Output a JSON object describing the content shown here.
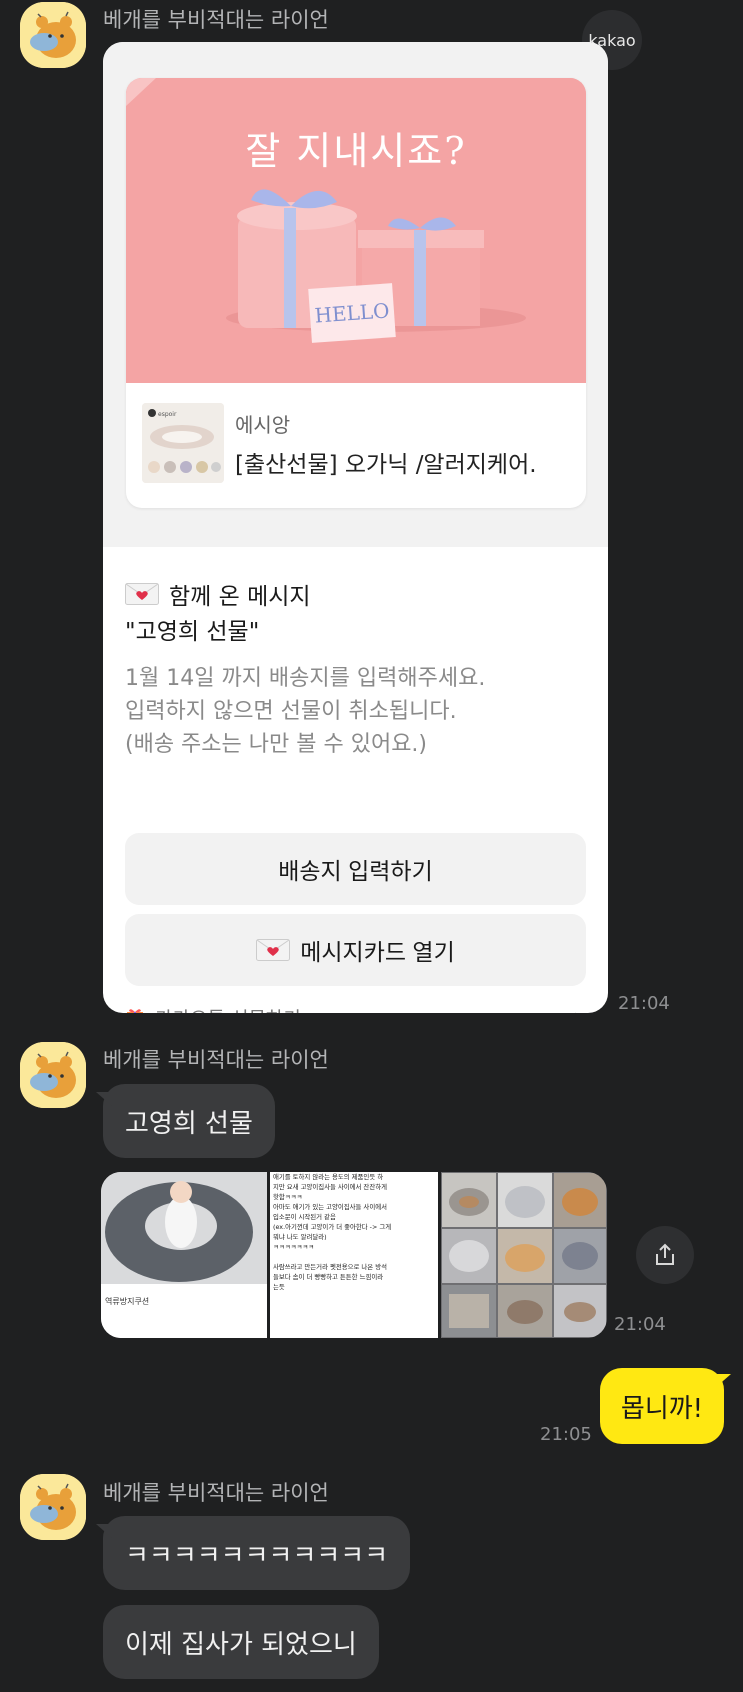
{
  "messages": {
    "sender_1": "베개를 부비적대는 라이언",
    "sender_2": "베개를 부비적대는 라이언",
    "sender_3": "베개를 부비적대는 라이언",
    "kakao_badge": "kakao",
    "time_1": "21:04",
    "time_2": "21:04",
    "time_3": "21:05",
    "bubble_gift_name": "고영희 선물",
    "my_reply": "몹니까!",
    "bubble_laugh": "ㅋㅋㅋㅋㅋㅋㅋㅋㅋㅋㅋ",
    "bubble_last": "이제 집사가 되었으니"
  },
  "gift": {
    "headline": "잘 지내시죠?",
    "card_text": "HELLO",
    "brand": "에시앙",
    "product_title": "[출산선물] 오가닉 /알러지케어.",
    "message_heading": "함께 온 메시지",
    "message_quote": "\"고영희 선물\"",
    "notice_line_1": "1월 14일 까지 배송지를 입력해주세요.",
    "notice_line_2": "입력하지 않으면 선물이 취소됩니다.",
    "notice_line_3": "(배송 주소는 나만 볼 수 있어요.)",
    "address_button": "배송지 입력하기",
    "message_card_button": "메시지카드 열기",
    "footer_label": "카카오톡 선물하기",
    "thumb_brand": "espoir"
  },
  "photos": {
    "photo_1_caption": "역류방지쿠션",
    "photo_2_lines": [
      "애기를 토하지 않라는 용도의 제품인듯 하",
      "지만 요새 고양이집사들 사이에서 잔잔하게",
      "핫함ㅋㅋㅋ",
      "아마도 애기가 있는 고양이집사들 사이에서",
      "입소문이 시작된거 같음",
      "(ex.아기껀데 고양이가 더 좋아한다 -> 그게",
      "뭐냐 나도 알려달라)",
      "ㅋㅋㅋㅋㅋㅋㅋ",
      "",
      "사람쓰라고 만든거라 펫전용으로 나온 방석",
      "들보다 솜이 더 빵빵하고 튼튼한 느낌이라",
      "는듯"
    ]
  },
  "icons": {
    "avatar": "ryan-avatar-icon",
    "envelope": "envelope-heart-icon",
    "gift": "gift-box-icon",
    "chevron": "chevron-right-icon",
    "share": "share-icon"
  },
  "colors": {
    "background": "#1f2021",
    "my_bubble": "#ffe812",
    "other_bubble": "#3a3b3d",
    "gift_pink": "#f4a4a4"
  }
}
